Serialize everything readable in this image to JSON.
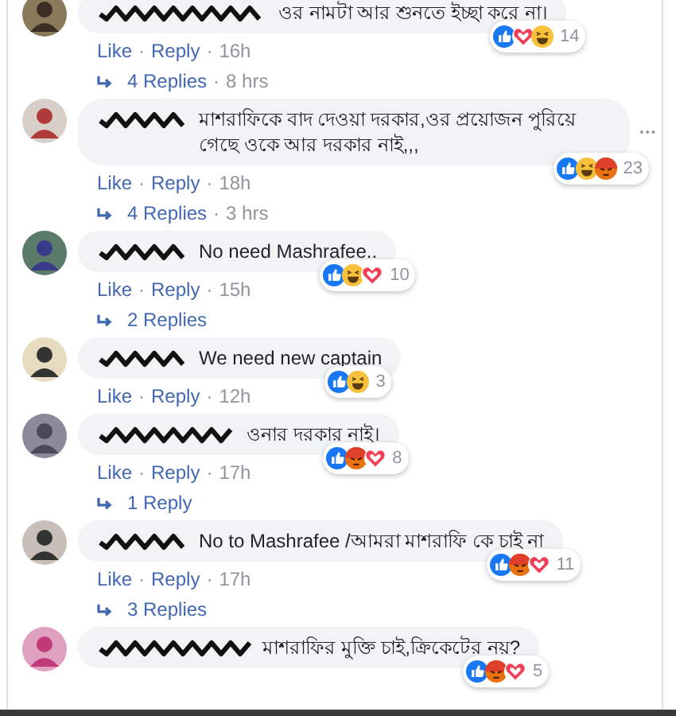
{
  "comments": [
    {
      "text": "ওর নামটা আর শুনতে ইচ্ছা করে না।",
      "menu_shown": false,
      "reactions": {
        "items": [
          {
            "kind": "like"
          },
          {
            "kind": "love"
          },
          {
            "kind": "haha"
          }
        ],
        "count": "14"
      },
      "actions": [
        {
          "text": "Like",
          "kind": "link"
        },
        {
          "text": "·",
          "kind": "meta"
        },
        {
          "text": "Reply",
          "kind": "link"
        },
        {
          "text": "·",
          "kind": "meta"
        },
        {
          "text": "16h",
          "kind": "meta"
        }
      ],
      "replies": [
        {
          "text": "4 Replies",
          "kind": "link"
        },
        {
          "text": "·",
          "kind": "meta"
        },
        {
          "text": "8 hrs",
          "kind": "meta"
        }
      ]
    },
    {
      "text": "মাশরাফিকে বাদ দেওয়া দরকার,ওর প্রয়োজন পুরিয়ে গেছে ওকে আর দরকার নাই,,,",
      "menu_shown": true,
      "reactions": {
        "items": [
          {
            "kind": "like"
          },
          {
            "kind": "haha"
          },
          {
            "kind": "angry"
          }
        ],
        "count": "23"
      },
      "actions": [
        {
          "text": "Like",
          "kind": "link"
        },
        {
          "text": "·",
          "kind": "meta"
        },
        {
          "text": "Reply",
          "kind": "link"
        },
        {
          "text": "·",
          "kind": "meta"
        },
        {
          "text": "18h",
          "kind": "meta"
        }
      ],
      "replies": [
        {
          "text": "4 Replies",
          "kind": "link"
        },
        {
          "text": "·",
          "kind": "meta"
        },
        {
          "text": "3 hrs",
          "kind": "meta"
        }
      ]
    },
    {
      "text": "No need Mashrafee..",
      "menu_shown": false,
      "reactions": {
        "items": [
          {
            "kind": "like"
          },
          {
            "kind": "haha"
          },
          {
            "kind": "love"
          }
        ],
        "count": "10"
      },
      "actions": [
        {
          "text": "Like",
          "kind": "link"
        },
        {
          "text": "·",
          "kind": "meta"
        },
        {
          "text": "Reply",
          "kind": "link"
        },
        {
          "text": "·",
          "kind": "meta"
        },
        {
          "text": "15h",
          "kind": "meta"
        }
      ],
      "replies": [
        {
          "text": "2 Replies",
          "kind": "link"
        }
      ]
    },
    {
      "text": "We need new captain",
      "menu_shown": false,
      "reactions": {
        "items": [
          {
            "kind": "like"
          },
          {
            "kind": "haha"
          }
        ],
        "count": "3"
      },
      "actions": [
        {
          "text": "Like",
          "kind": "link"
        },
        {
          "text": "·",
          "kind": "meta"
        },
        {
          "text": "Reply",
          "kind": "link"
        },
        {
          "text": "·",
          "kind": "meta"
        },
        {
          "text": "12h",
          "kind": "meta"
        }
      ]
    },
    {
      "text": "ওনার দরকার নাই।",
      "menu_shown": false,
      "reactions": {
        "items": [
          {
            "kind": "like"
          },
          {
            "kind": "angry"
          },
          {
            "kind": "love"
          }
        ],
        "count": "8"
      },
      "actions": [
        {
          "text": "Like",
          "kind": "link"
        },
        {
          "text": "·",
          "kind": "meta"
        },
        {
          "text": "Reply",
          "kind": "link"
        },
        {
          "text": "·",
          "kind": "meta"
        },
        {
          "text": "17h",
          "kind": "meta"
        }
      ],
      "replies": [
        {
          "text": "1 Reply",
          "kind": "link"
        }
      ]
    },
    {
      "text": "No to Mashrafee /আমরা মাশরাফি কে চাই না",
      "menu_shown": false,
      "reactions": {
        "items": [
          {
            "kind": "like"
          },
          {
            "kind": "angry"
          },
          {
            "kind": "love"
          }
        ],
        "count": "11"
      },
      "actions": [
        {
          "text": "Like",
          "kind": "link"
        },
        {
          "text": "·",
          "kind": "meta"
        },
        {
          "text": "Reply",
          "kind": "link"
        },
        {
          "text": "·",
          "kind": "meta"
        },
        {
          "text": "17h",
          "kind": "meta"
        }
      ],
      "replies": [
        {
          "text": "3 Replies",
          "kind": "link"
        }
      ]
    },
    {
      "text": "মাশরাফির মুক্তি চাই,ক্রিকেটের নয়?",
      "menu_shown": false,
      "reactions": {
        "items": [
          {
            "kind": "like"
          },
          {
            "kind": "angry"
          },
          {
            "kind": "love"
          }
        ],
        "count": "5"
      }
    }
  ]
}
